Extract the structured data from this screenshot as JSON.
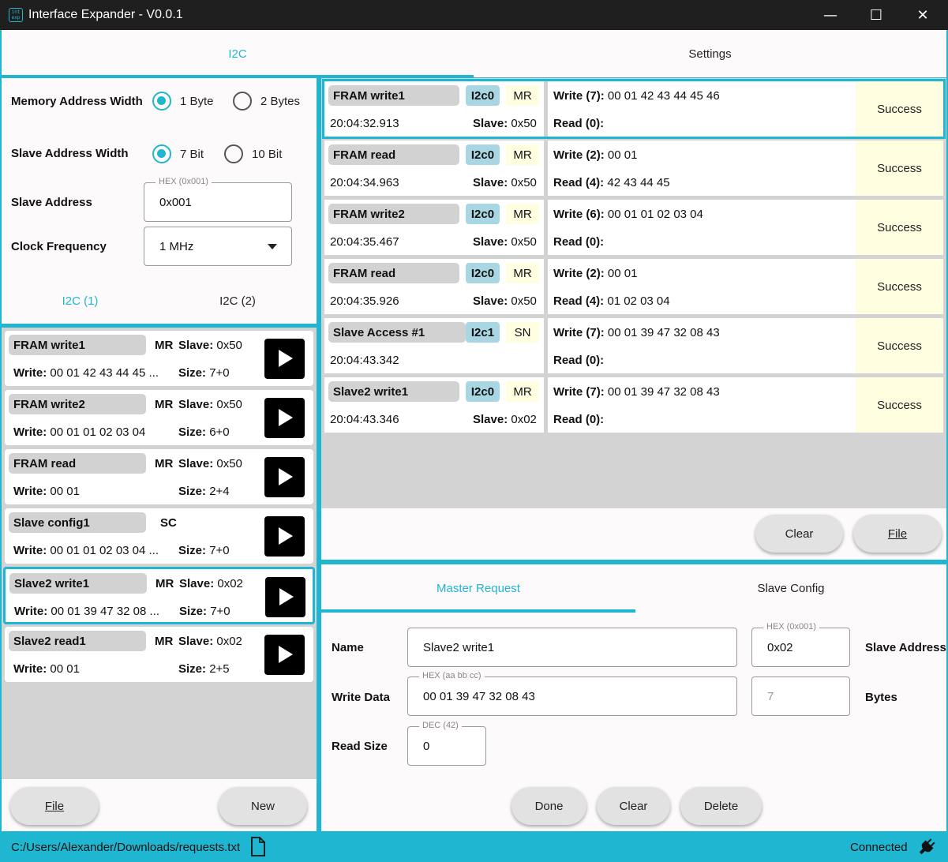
{
  "window": {
    "title": "Interface Expander - V0.0.1",
    "icon_text": "int exp",
    "minimize": "—",
    "maximize": "☐",
    "close": "✕"
  },
  "tabs": {
    "i2c": "I2C",
    "settings": "Settings"
  },
  "settings": {
    "mem_width_label": "Memory Address Width",
    "mem_opt1": "1 Byte",
    "mem_opt2": "2 Bytes",
    "slave_width_label": "Slave Address Width",
    "slave_opt1": "7 Bit",
    "slave_opt2": "10 Bit",
    "slave_addr_label": "Slave Address",
    "slave_addr_hint": "HEX (0x001)",
    "slave_addr_value": "0x001",
    "clock_label": "Clock Frequency",
    "clock_value": "1 MHz"
  },
  "subtabs": {
    "i2c1": "I2C (1)",
    "i2c2": "I2C (2)"
  },
  "requests": [
    {
      "name": "FRAM write1",
      "mode": "MR",
      "slave_label": "Slave:",
      "slave": "0x50",
      "write_label": "Write:",
      "write": "00 01 42 43 44 45 ...",
      "size_label": "Size:",
      "size": "7+0"
    },
    {
      "name": "FRAM write2",
      "mode": "MR",
      "slave_label": "Slave:",
      "slave": "0x50",
      "write_label": "Write:",
      "write": "00 01 01 02 03 04",
      "size_label": "Size:",
      "size": "6+0"
    },
    {
      "name": "FRAM read",
      "mode": "MR",
      "slave_label": "Slave:",
      "slave": "0x50",
      "write_label": "Write:",
      "write": "00 01",
      "size_label": "Size:",
      "size": "2+4"
    },
    {
      "name": "Slave config1",
      "mode": "SC",
      "slave_label": "",
      "slave": "",
      "write_label": "Write:",
      "write": "00 01 01 02 03 04 ...",
      "size_label": "Size:",
      "size": "7+0"
    },
    {
      "name": "Slave2 write1",
      "mode": "MR",
      "slave_label": "Slave:",
      "slave": "0x02",
      "write_label": "Write:",
      "write": "00 01 39 47 32 08 ...",
      "size_label": "Size:",
      "size": "7+0"
    },
    {
      "name": "Slave2 read1",
      "mode": "MR",
      "slave_label": "Slave:",
      "slave": "0x02",
      "write_label": "Write:",
      "write": "00 01",
      "size_label": "Size:",
      "size": "2+5"
    }
  ],
  "left_buttons": {
    "file": "File",
    "new": "New"
  },
  "log": [
    {
      "name": "FRAM write1",
      "bus": "I2c0",
      "mode": "MR",
      "time": "20:04:32.913",
      "slave_label": "Slave:",
      "slave": "0x50",
      "write_label": "Write (7):",
      "write": "00 01 42 43 44 45 46",
      "read_label": "Read (0):",
      "read": "",
      "status": "Success"
    },
    {
      "name": "FRAM read",
      "bus": "I2c0",
      "mode": "MR",
      "time": "20:04:34.963",
      "slave_label": "Slave:",
      "slave": "0x50",
      "write_label": "Write (2):",
      "write": "00 01",
      "read_label": "Read (4):",
      "read": "42 43 44 45",
      "status": "Success"
    },
    {
      "name": "FRAM write2",
      "bus": "I2c0",
      "mode": "MR",
      "time": "20:04:35.467",
      "slave_label": "Slave:",
      "slave": "0x50",
      "write_label": "Write (6):",
      "write": "00 01 01 02 03 04",
      "read_label": "Read (0):",
      "read": "",
      "status": "Success"
    },
    {
      "name": "FRAM read",
      "bus": "I2c0",
      "mode": "MR",
      "time": "20:04:35.926",
      "slave_label": "Slave:",
      "slave": "0x50",
      "write_label": "Write (2):",
      "write": "00 01",
      "read_label": "Read (4):",
      "read": "01 02 03 04",
      "status": "Success"
    },
    {
      "name": "Slave Access #1",
      "bus": "I2c1",
      "mode": "SN",
      "time": "20:04:43.342",
      "slave_label": "",
      "slave": "",
      "write_label": "Write (7):",
      "write": "00 01 39 47 32 08 43",
      "read_label": "Read (0):",
      "read": "",
      "status": "Success"
    },
    {
      "name": "Slave2 write1",
      "bus": "I2c0",
      "mode": "MR",
      "time": "20:04:43.346",
      "slave_label": "Slave:",
      "slave": "0x02",
      "write_label": "Write (7):",
      "write": "00 01 39 47 32 08 43",
      "read_label": "Read (0):",
      "read": "",
      "status": "Success"
    }
  ],
  "log_buttons": {
    "clear": "Clear",
    "file": "File"
  },
  "editor": {
    "tab_master": "Master Request",
    "tab_slave": "Slave Config",
    "name_label": "Name",
    "name_value": "Slave2 write1",
    "slave_addr_hint": "HEX (0x001)",
    "slave_addr_value": "0x02",
    "slave_addr_label": "Slave Address",
    "write_label": "Write Data",
    "write_hint": "HEX (aa bb cc)",
    "write_value": "00 01 39 47 32 08 43",
    "bytes_value": "7",
    "bytes_label": "Bytes",
    "read_label": "Read Size",
    "read_hint": "DEC (42)",
    "read_value": "0",
    "done": "Done",
    "clear": "Clear",
    "delete": "Delete"
  },
  "status": {
    "path": "C:/Users/Alexander/Downloads/requests.txt",
    "connection": "Connected"
  },
  "colors": {
    "accent": "#1fb6d1",
    "success_bg": "#fffee0",
    "bus_bg": "#a9d6e3"
  }
}
